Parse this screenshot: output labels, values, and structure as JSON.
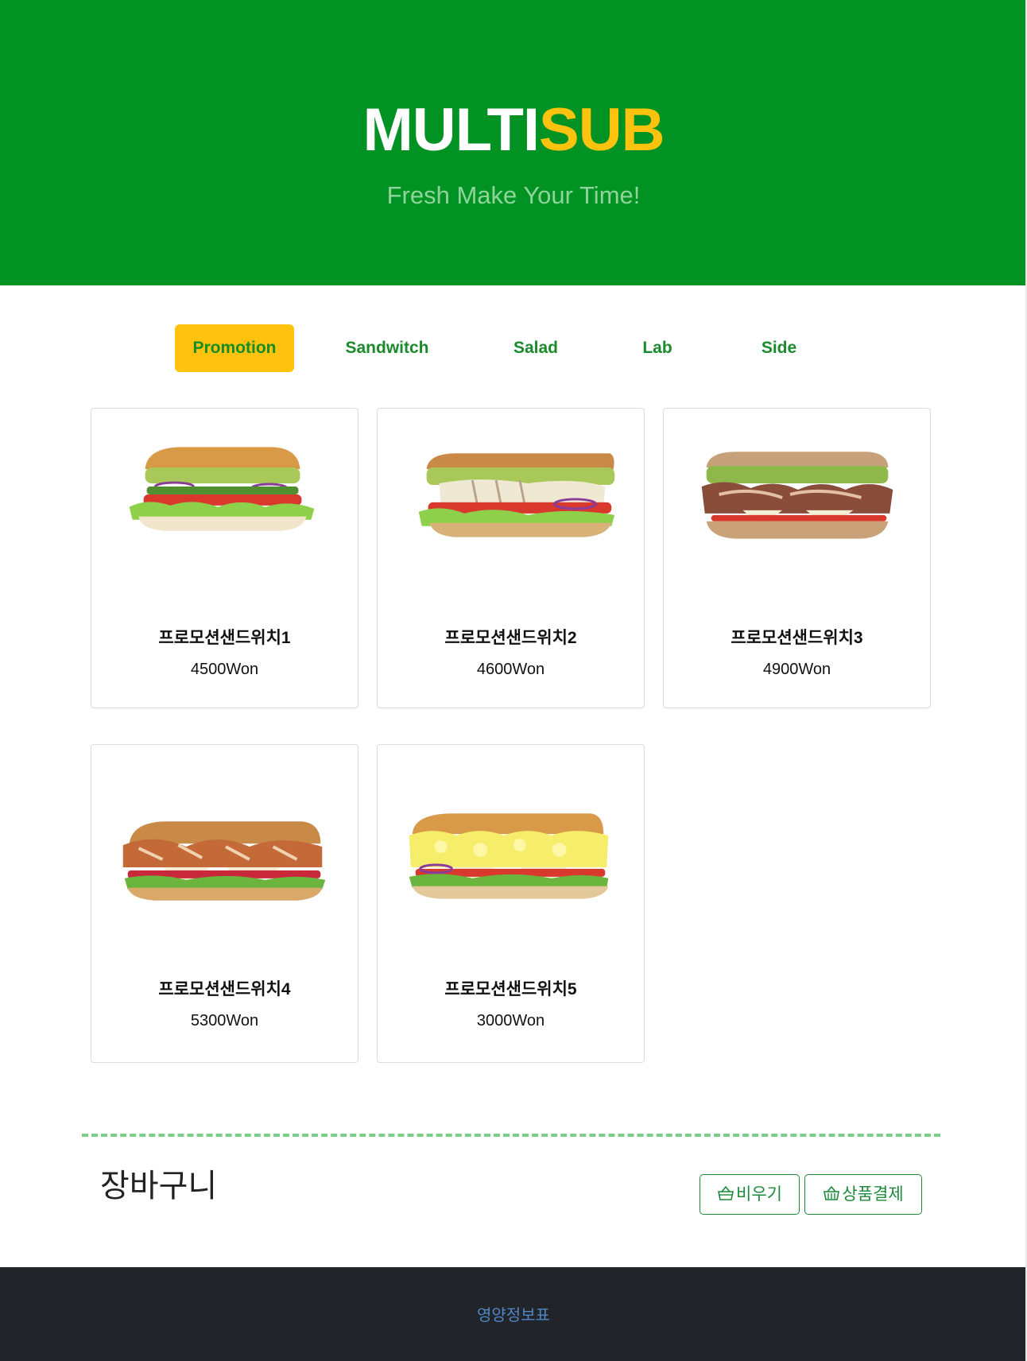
{
  "header": {
    "brand_white": "MULTI",
    "brand_yellow": "SUB",
    "tagline": "Fresh Make Your Time!"
  },
  "tabs": [
    {
      "label": "Promotion",
      "active": true
    },
    {
      "label": "Sandwitch",
      "active": false
    },
    {
      "label": "Salad",
      "active": false
    },
    {
      "label": "Lab",
      "active": false
    },
    {
      "label": "Side",
      "active": false
    }
  ],
  "products": [
    {
      "name": "프로모션샌드위치1",
      "price": "4500Won",
      "image_icon": "avocado-veggie-sandwich-image"
    },
    {
      "name": "프로모션샌드위치2",
      "price": "4600Won",
      "image_icon": "chicken-avocado-sandwich-image"
    },
    {
      "name": "프로모션샌드위치3",
      "price": "4900Won",
      "image_icon": "turkey-avocado-sandwich-image"
    },
    {
      "name": "프로모션샌드위치4",
      "price": "5300Won",
      "image_icon": "pulled-chicken-sandwich-image"
    },
    {
      "name": "프로모션샌드위치5",
      "price": "3000Won",
      "image_icon": "egg-mayo-sandwich-image"
    }
  ],
  "cart": {
    "title": "장바구니",
    "clear_label": "비우기",
    "checkout_label": "상품결제"
  },
  "footer": {
    "link_label": "영양정보표"
  },
  "colors": {
    "brand_green": "#009223",
    "brand_yellow": "#ffc20e",
    "footer_dark": "#212529"
  }
}
